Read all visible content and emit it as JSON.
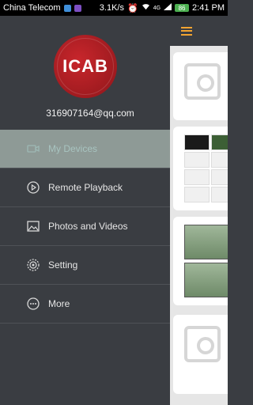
{
  "status_bar": {
    "carrier": "China Telecom",
    "speed": "3.1K/s",
    "network": "4G",
    "battery": "86",
    "time": "2:41 PM"
  },
  "drawer": {
    "logo_text": "ICAB",
    "email": "316907164@qq.com",
    "items": [
      {
        "label": "My Devices",
        "icon": "video-camera-icon",
        "active": true
      },
      {
        "label": "Remote Playback",
        "icon": "play-circle-icon",
        "active": false
      },
      {
        "label": "Photos and Videos",
        "icon": "image-icon",
        "active": false
      },
      {
        "label": "Setting",
        "icon": "gear-icon",
        "active": false
      },
      {
        "label": "More",
        "icon": "more-dots-icon",
        "active": false
      }
    ]
  },
  "colors": {
    "drawer_bg": "#3a3d42",
    "active_item_bg": "#8e9a96",
    "accent": "#f2a431",
    "logo_red": "#c8262c"
  }
}
